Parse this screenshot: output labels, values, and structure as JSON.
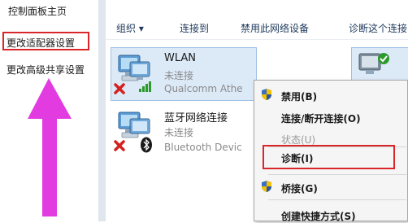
{
  "left_pane": {
    "home": "控制面板主页",
    "adapter_settings": "更改适配器设置",
    "sharing_settings": "更改高级共享设置"
  },
  "toolbar": {
    "organize": "组织 ▾",
    "connect_to": "连接到",
    "disable": "禁用此网络设备",
    "diagnose": "诊断这个连接"
  },
  "items": [
    {
      "name": "WLAN",
      "status": "未连接",
      "adapter": "Qualcomm Athe"
    },
    {
      "name": "蓝牙网络连接",
      "status": "未连接",
      "adapter": "Bluetooth Devic"
    }
  ],
  "context_menu": {
    "disable": "禁用(B)",
    "connect_disconnect": "连接/断开连接(O)",
    "status": "状态(U)",
    "diagnose": "诊断(I)",
    "bridge": "桥接(G)",
    "shortcut": "创建快捷方式(S)"
  },
  "colors": {
    "highlight_border": "#d9262b",
    "arrow": "#e23be0",
    "selection": "#dce9f7",
    "toolbar_text": "#1e395b"
  }
}
